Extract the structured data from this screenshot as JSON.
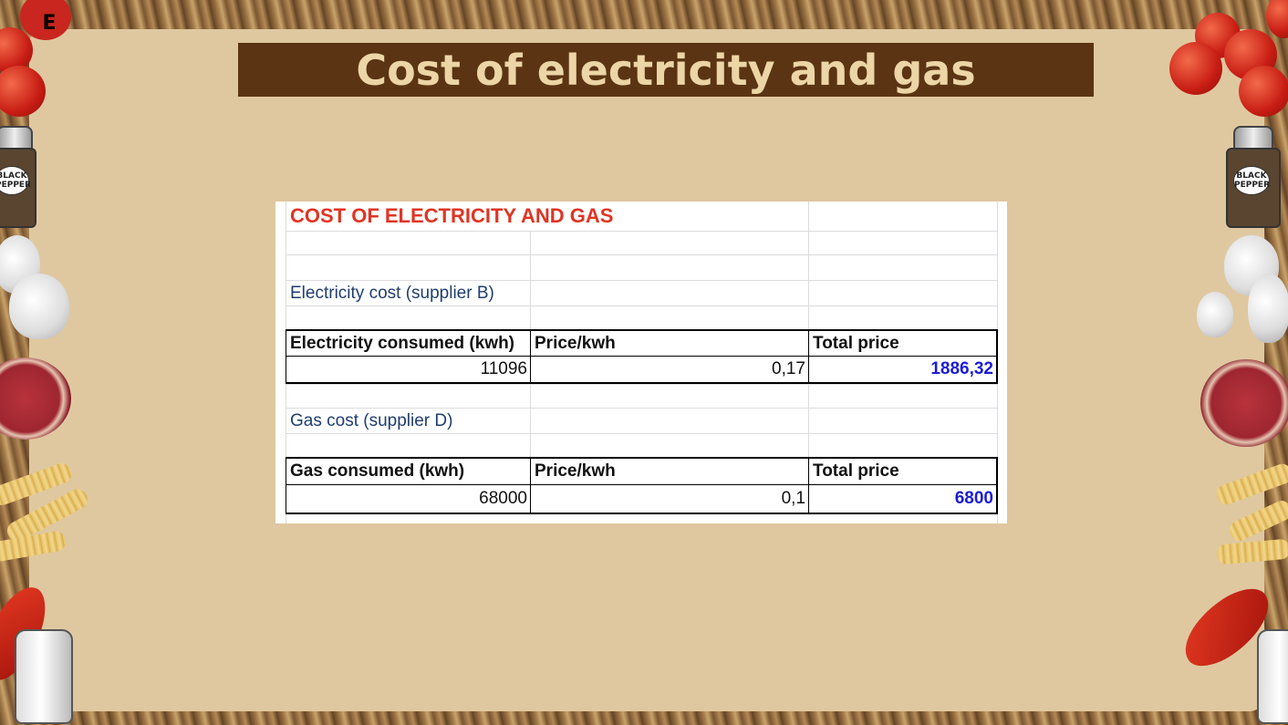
{
  "slide": {
    "title": "Cost of electricity and gas",
    "badge": "E",
    "pepper_label_line1": "BLACK",
    "pepper_label_line2": "PEPPER"
  },
  "spreadsheet": {
    "heading": "COST OF ELECTRICITY AND GAS",
    "electricity": {
      "section_label": "Electricity cost (supplier B)",
      "columns": [
        "Electricity consumed (kwh)",
        "Price/kwh",
        "Total price"
      ],
      "row": [
        "11096",
        "0,17",
        "1886,32"
      ]
    },
    "gas": {
      "section_label": "Gas cost (supplier D)",
      "columns": [
        "Gas consumed (kwh)",
        "Price/kwh",
        "Total price"
      ],
      "row": [
        "68000",
        "0,1",
        "6800"
      ]
    }
  },
  "colors": {
    "title_bar": "#5a3413",
    "title_text": "#ecd5a6",
    "slide_bg": "#dfc8a0",
    "heading_red": "#e03424",
    "section_blue": "#1f3e6e",
    "total_blue": "#1c1cd8"
  }
}
